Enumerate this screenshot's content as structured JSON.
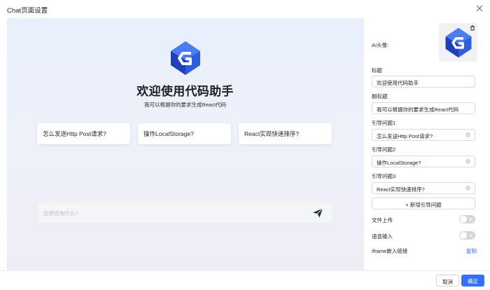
{
  "dialog": {
    "title": "Chat页面设置"
  },
  "preview": {
    "welcome": "欢迎使用代码助手",
    "subtitle": "我可以根据你的要求生成React代码",
    "suggestions": [
      "怎么发送Http Post请求?",
      "操作LocalStorage?",
      "React实现快速排序?"
    ],
    "input_placeholder": "您想咨询什么?"
  },
  "settings": {
    "avatar_label": "AI头像:",
    "title_label": "标题",
    "title_value": "欢迎使用代码助手",
    "subtitle_label": "副标题",
    "subtitle_value": "我可以根据你的要求生成React代码",
    "guides": [
      {
        "label": "引导问题1",
        "value": "怎么发送Http Post请求?"
      },
      {
        "label": "引导问题2",
        "value": "操作LocalStorage?"
      },
      {
        "label": "引导问题3",
        "value": "React实现快速排序?"
      }
    ],
    "add_guide": "+ 新增引导问题",
    "file_upload_label": "文件上传",
    "file_upload_toggle": "关",
    "voice_input_label": "语音输入",
    "voice_input_toggle": "关",
    "iframe_label": "Iframe嵌入链接",
    "copy_label": "复制"
  },
  "footer": {
    "cancel": "取消",
    "confirm": "确定"
  },
  "colors": {
    "accent": "#3370ff",
    "logo_dark": "#1f3fbf",
    "logo_light": "#4a78f0",
    "toggle_off": "#d2d6dc"
  }
}
